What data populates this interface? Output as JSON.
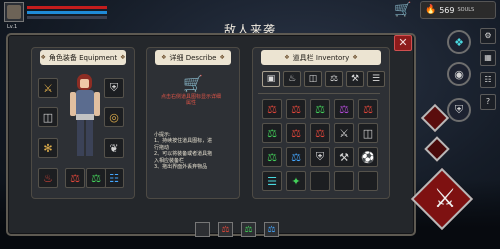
{
  "hud": {
    "level": "Lv.1",
    "currency_value": "569",
    "currency_unit": "SOULS",
    "cart_icon": "cart-icon",
    "fire_icon": "fire-icon"
  },
  "title": "敌人来袭",
  "equipment": {
    "title": "角色装备 Equipment",
    "left_slots": [
      "crossed-swords-icon",
      "chest-armor-icon",
      "amulet-icon",
      "helmet-icon"
    ],
    "right_slots": [
      "shield-icon",
      "ring-icon",
      "feather-icon",
      "tome-icon"
    ],
    "bottom_slots": [
      "red-potion-icon",
      "green-potion-icon",
      "blue-potion-icon"
    ]
  },
  "describe": {
    "title": "详细 Describe",
    "hint": "点击右侧道具图标显示详细属性",
    "tips": [
      "小提示:",
      "1、持续按住道具图标，进",
      "行拖动",
      "2、可以将装备或者道具拖",
      "入相应装备栏",
      "3、拖出界面外丢弃物品"
    ]
  },
  "inventory": {
    "title": "道具栏 Inventory",
    "tabs": [
      "all-tab-icon",
      "helmet-tab-icon",
      "armor-tab-icon",
      "potion-tab-icon",
      "weapon-tab-icon",
      "scroll-tab-icon"
    ],
    "items": [
      [
        "red-potion-icon",
        "red-potion-icon",
        "green-potion-icon",
        "purple-potion-icon",
        "red-potion-icon"
      ],
      [
        "green-potion-icon",
        "red-potion-icon",
        "red-potion-icon",
        "sword-icon",
        "breastplate-icon"
      ],
      [
        "green-potion-icon",
        "blue-potion-icon",
        "shield-icon",
        "axe-icon",
        "boots-icon"
      ],
      [
        "scroll-icon",
        "wand-icon",
        "",
        "",
        ""
      ]
    ]
  },
  "colors": {
    "panel": "#24272b",
    "header": "#ece4d2",
    "hp": "#c41d1d",
    "mp": "#1f8bd8",
    "close": "#8d1b1b"
  },
  "hotbar": [
    "empty-slot-icon",
    "red-potion-icon",
    "green-potion-icon",
    "blue-potion-icon"
  ]
}
